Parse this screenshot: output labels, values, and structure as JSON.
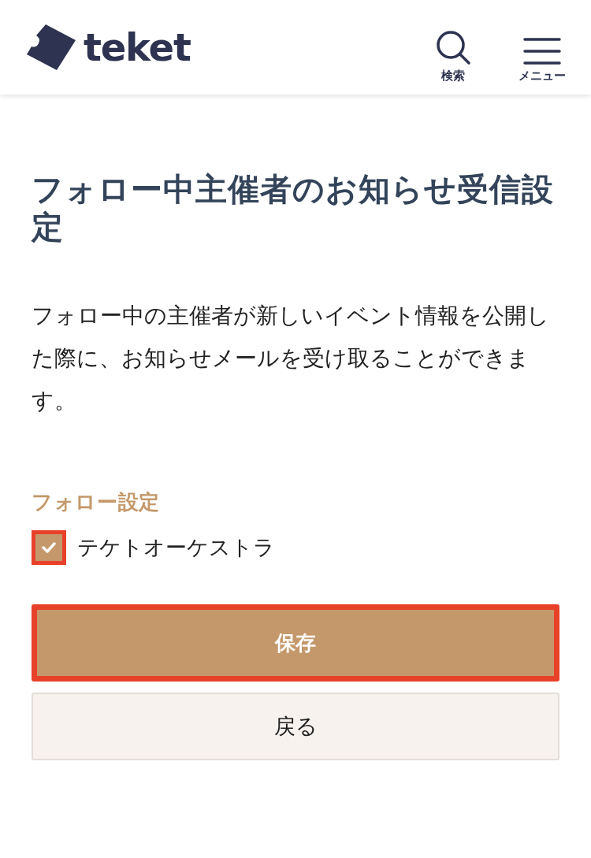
{
  "header": {
    "logo_text": "teket",
    "actions": [
      {
        "kind": "search",
        "label": "検索"
      },
      {
        "kind": "menu",
        "label": "メニュー"
      }
    ]
  },
  "title": "フォロー中主催者のお知らせ受信設定",
  "description": "フォロー中の主催者が新しいイベント情報を公開した際に、お知らせメールを受け取ることができます。",
  "section_label": "フォロー設定",
  "organizers": [
    {
      "name": "テケトオーケストラ",
      "checked": true,
      "highlighted": true
    }
  ],
  "buttons": [
    {
      "kind": "primary",
      "label": "保存",
      "highlighted": true
    },
    {
      "kind": "secondary",
      "label": "戻る",
      "highlighted": false
    }
  ]
}
